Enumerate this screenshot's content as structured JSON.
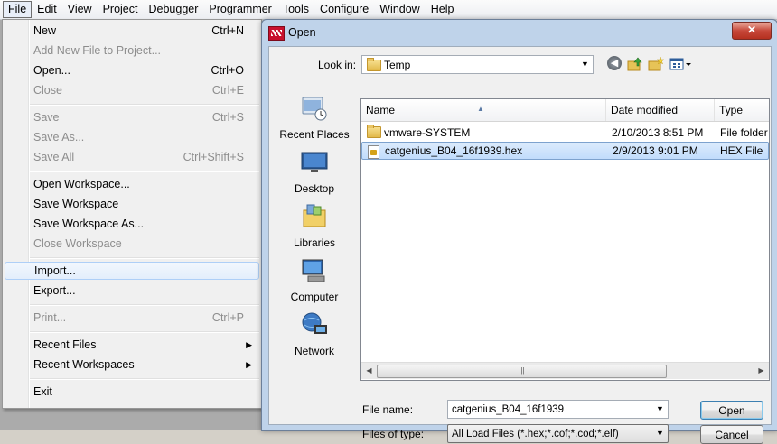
{
  "menubar": {
    "items": [
      "File",
      "Edit",
      "View",
      "Project",
      "Debugger",
      "Programmer",
      "Tools",
      "Configure",
      "Window",
      "Help"
    ]
  },
  "file_menu": {
    "items": [
      {
        "label": "New",
        "shortcut": "Ctrl+N",
        "enabled": true
      },
      {
        "label": "Add New File to Project...",
        "shortcut": "",
        "enabled": false
      },
      {
        "label": "Open...",
        "shortcut": "Ctrl+O",
        "enabled": true
      },
      {
        "label": "Close",
        "shortcut": "Ctrl+E",
        "enabled": false
      },
      {
        "label": "Save",
        "shortcut": "Ctrl+S",
        "enabled": false
      },
      {
        "label": "Save As...",
        "shortcut": "",
        "enabled": false
      },
      {
        "label": "Save All",
        "shortcut": "Ctrl+Shift+S",
        "enabled": false
      },
      {
        "label": "Open Workspace...",
        "shortcut": "",
        "enabled": true
      },
      {
        "label": "Save Workspace",
        "shortcut": "",
        "enabled": true
      },
      {
        "label": "Save Workspace As...",
        "shortcut": "",
        "enabled": true
      },
      {
        "label": "Close Workspace",
        "shortcut": "",
        "enabled": false
      },
      {
        "label": "Import...",
        "shortcut": "",
        "enabled": true,
        "highlighted": true
      },
      {
        "label": "Export...",
        "shortcut": "",
        "enabled": true
      },
      {
        "label": "Print...",
        "shortcut": "Ctrl+P",
        "enabled": false
      },
      {
        "label": "Recent Files",
        "shortcut": "",
        "enabled": true,
        "submenu": true
      },
      {
        "label": "Recent Workspaces",
        "shortcut": "",
        "enabled": true,
        "submenu": true
      },
      {
        "label": "Exit",
        "shortcut": "",
        "enabled": true
      }
    ]
  },
  "dialog": {
    "title": "Open",
    "close_label": "✕",
    "look_in_label": "Look in:",
    "look_in_value": "Temp",
    "places": [
      "Recent Places",
      "Desktop",
      "Libraries",
      "Computer",
      "Network"
    ],
    "columns": [
      "Name",
      "Date modified",
      "Type"
    ],
    "files": [
      {
        "name": "vmware-SYSTEM",
        "date": "2/10/2013 8:51 PM",
        "type": "File folder",
        "kind": "folder"
      },
      {
        "name": "catgenius_B04_16f1939.hex",
        "date": "2/9/2013 9:01 PM",
        "type": "HEX File",
        "kind": "hex",
        "selected": true
      }
    ],
    "file_name_label": "File name:",
    "file_name_value": "catgenius_B04_16f1939",
    "file_type_label": "Files of type:",
    "file_type_value": "All Load Files (*.hex;*.cof;*.cod;*.elf)",
    "open_button": "Open",
    "cancel_button": "Cancel"
  },
  "colors": {
    "dialog_frame": "#bfd3ea",
    "close_button": "#c7483a",
    "selection": "#c1dcfc"
  }
}
